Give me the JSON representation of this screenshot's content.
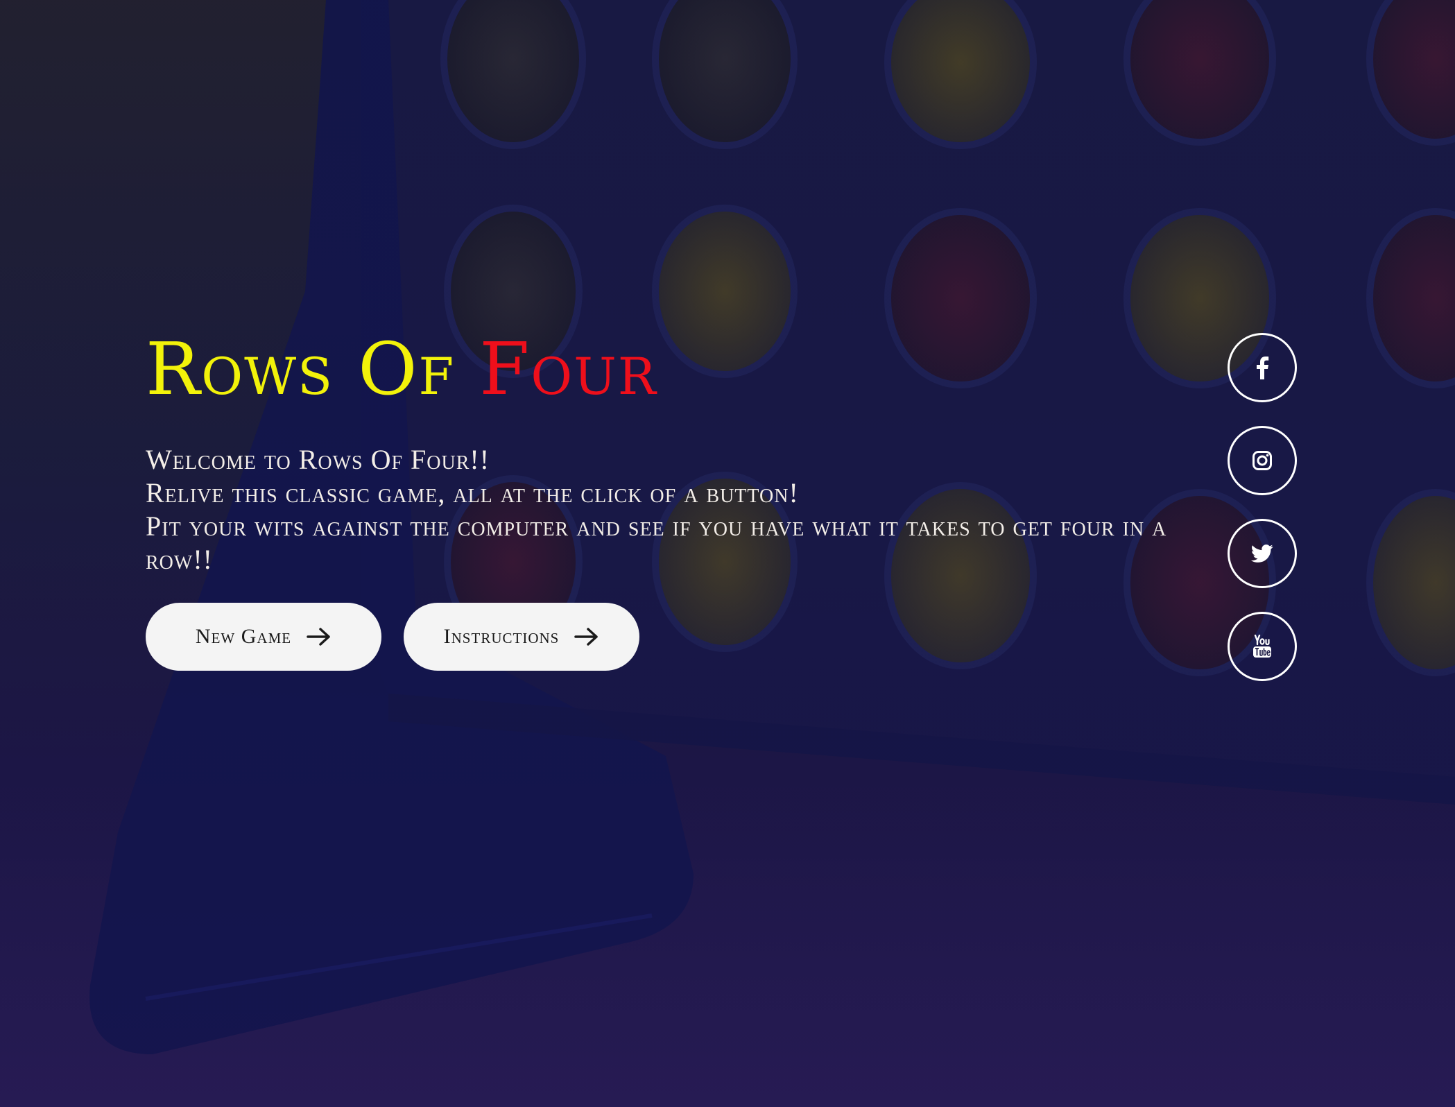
{
  "hero": {
    "title_part1": "Rows Of",
    "title_part2": "Four",
    "intro_lines": [
      "Welcome to Rows Of Four!!",
      "Relive this classic game, all at the click of a button!",
      "Pit your wits against the computer and see if you have what it takes to get four in a row!!"
    ]
  },
  "buttons": {
    "new_game": "New Game",
    "instructions": "Instructions"
  },
  "social": [
    {
      "name": "facebook",
      "icon": "facebook-icon"
    },
    {
      "name": "instagram",
      "icon": "instagram-icon"
    },
    {
      "name": "twitter",
      "icon": "twitter-icon"
    },
    {
      "name": "youtube",
      "icon": "youtube-icon"
    }
  ],
  "colors": {
    "title_yellow": "#f2f20a",
    "title_red": "#ee0f1b",
    "button_bg": "#f4f4f4",
    "text_light": "#f3eee8"
  }
}
